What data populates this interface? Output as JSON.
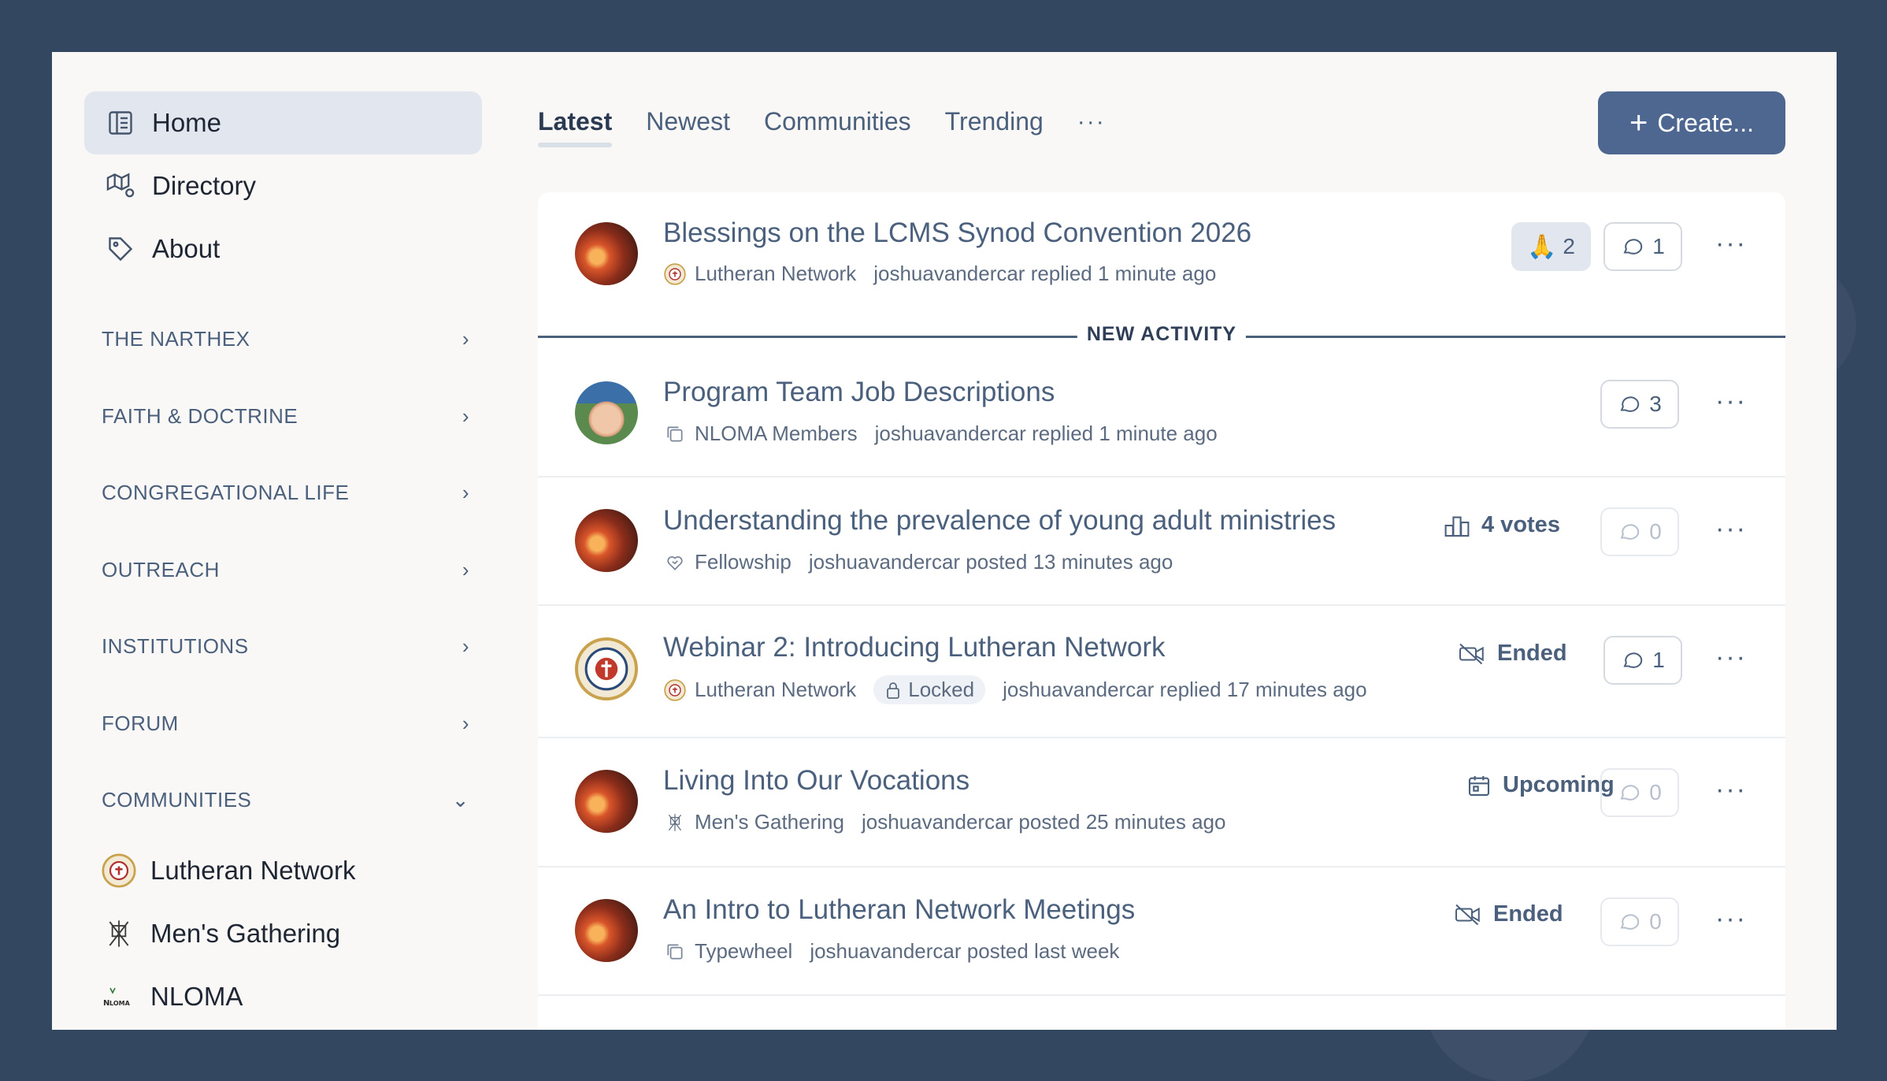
{
  "sidebar": {
    "nav": [
      {
        "label": "Home",
        "icon": "home-icon"
      },
      {
        "label": "Directory",
        "icon": "map-icon"
      },
      {
        "label": "About",
        "icon": "tag-icon"
      }
    ],
    "sections": [
      {
        "label": "THE NARTHEX"
      },
      {
        "label": "FAITH & DOCTRINE"
      },
      {
        "label": "CONGREGATIONAL LIFE"
      },
      {
        "label": "OUTREACH"
      },
      {
        "label": "INSTITUTIONS"
      },
      {
        "label": "FORUM"
      },
      {
        "label": "COMMUNITIES"
      }
    ],
    "communities": [
      {
        "label": "Lutheran Network"
      },
      {
        "label": "Men's Gathering"
      },
      {
        "label": "NLOMA"
      }
    ]
  },
  "tabs": [
    {
      "label": "Latest",
      "active": true
    },
    {
      "label": "Newest"
    },
    {
      "label": "Communities"
    },
    {
      "label": "Trending"
    }
  ],
  "create_label": "Create...",
  "divider_label": "NEW ACTIVITY",
  "topics": [
    {
      "title": "Blessings on the LCMS Synod Convention 2026",
      "category": "Lutheran Network",
      "activity": "joshuavandercar replied 1 minute ago",
      "reactions": "2",
      "replies": "1"
    },
    {
      "title": "Program Team Job Descriptions",
      "category": "NLOMA Members",
      "activity": "joshuavandercar replied 1 minute ago",
      "replies": "3"
    },
    {
      "title": "Understanding the prevalence of young adult ministries",
      "category": "Fellowship",
      "activity": "joshuavandercar posted 13 minutes ago",
      "status": "4 votes",
      "replies": "0"
    },
    {
      "title": "Webinar 2: Introducing Lutheran Network",
      "category": "Lutheran Network",
      "locked": "Locked",
      "activity": "joshuavandercar replied 17 minutes ago",
      "status": "Ended",
      "replies": "1"
    },
    {
      "title": "Living Into Our Vocations",
      "category": "Men's Gathering",
      "activity": "joshuavandercar posted 25 minutes ago",
      "status": "Upcoming",
      "replies": "0"
    },
    {
      "title": "An Intro to Lutheran Network Meetings",
      "category": "Typewheel",
      "activity": "joshuavandercar posted last week",
      "status": "Ended",
      "replies": "0"
    }
  ],
  "colors": {
    "accent": "#4e6790",
    "background": "#344761",
    "link": "#4b607c"
  }
}
